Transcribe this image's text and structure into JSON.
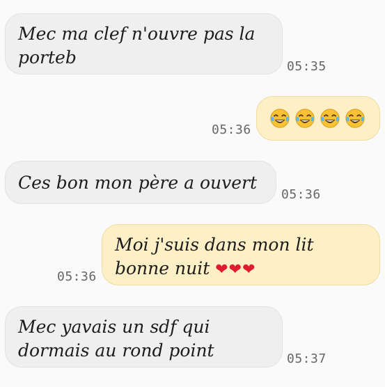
{
  "messages": [
    {
      "direction": "incoming",
      "text": "Mec ma clef n'ouvre pas la\nporteb",
      "time": "05:35"
    },
    {
      "direction": "outgoing",
      "emoji": [
        "face-with-tears-of-joy",
        "face-with-tears-of-joy",
        "face-with-tears-of-joy",
        "face-with-tears-of-joy"
      ],
      "time": "05:36"
    },
    {
      "direction": "incoming",
      "text": "Ces bon mon père a ouvert",
      "time": "05:36"
    },
    {
      "direction": "outgoing",
      "text_line1": "Moi j'suis dans mon lit",
      "text_line2": "bonne nuit",
      "hearts": "❤❤❤",
      "time": "05:36"
    },
    {
      "direction": "incoming",
      "text": "Mec yavais un sdf qui\ndormais au rond point",
      "time": "05:37"
    }
  ],
  "colors": {
    "incoming_bubble": "#efefef",
    "outgoing_bubble": "#fdefc6",
    "heart": "#e01c2f",
    "emoji_face": "#f7c234"
  }
}
